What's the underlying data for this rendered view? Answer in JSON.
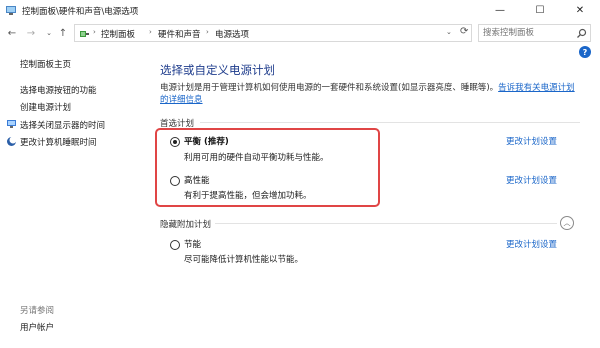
{
  "window": {
    "title": "控制面板\\硬件和声音\\电源选项",
    "minimize": "—",
    "maximize": "☐",
    "close": "✕"
  },
  "nav": {
    "back": "←",
    "forward": "→",
    "history": "⌄",
    "up": "↑"
  },
  "address": {
    "crumbs": [
      "控制面板",
      "硬件和声音",
      "电源选项"
    ],
    "separator": "›",
    "dropdown": "⌄",
    "refresh": "⟳"
  },
  "search": {
    "placeholder": "搜索控制面板"
  },
  "sidebar": {
    "home": "控制面板主页",
    "links": [
      "选择电源按钮的功能",
      "创建电源计划",
      "选择关闭显示器的时间",
      "更改计算机睡眠时间"
    ],
    "see_also": "另请参阅",
    "user_accounts": "用户帐户"
  },
  "help": "?",
  "main": {
    "title": "选择或自定义电源计划",
    "description": "电源计划是用于管理计算机如何使用电源的一套硬件和系统设置(如显示器亮度、睡眠等)。",
    "description_link": "告诉我有关电源计划的详细信息",
    "preferred_header": "首选计划",
    "hidden_header": "隐藏附加计划",
    "collapse_glyph": "︿",
    "plans": [
      {
        "name": "平衡 (推荐)",
        "desc": "利用可用的硬件自动平衡功耗与性能。",
        "link": "更改计划设置",
        "selected": true
      },
      {
        "name": "高性能",
        "desc": "有利于提高性能，但会增加功耗。",
        "link": "更改计划设置",
        "selected": false
      }
    ],
    "hidden_plans": [
      {
        "name": "节能",
        "desc": "尽可能降低计算机性能以节能。",
        "link": "更改计划设置",
        "selected": false
      }
    ]
  },
  "colors": {
    "accent_link": "#1a66c9",
    "title_blue": "#1e3c8c",
    "highlight_red": "#e04545"
  }
}
